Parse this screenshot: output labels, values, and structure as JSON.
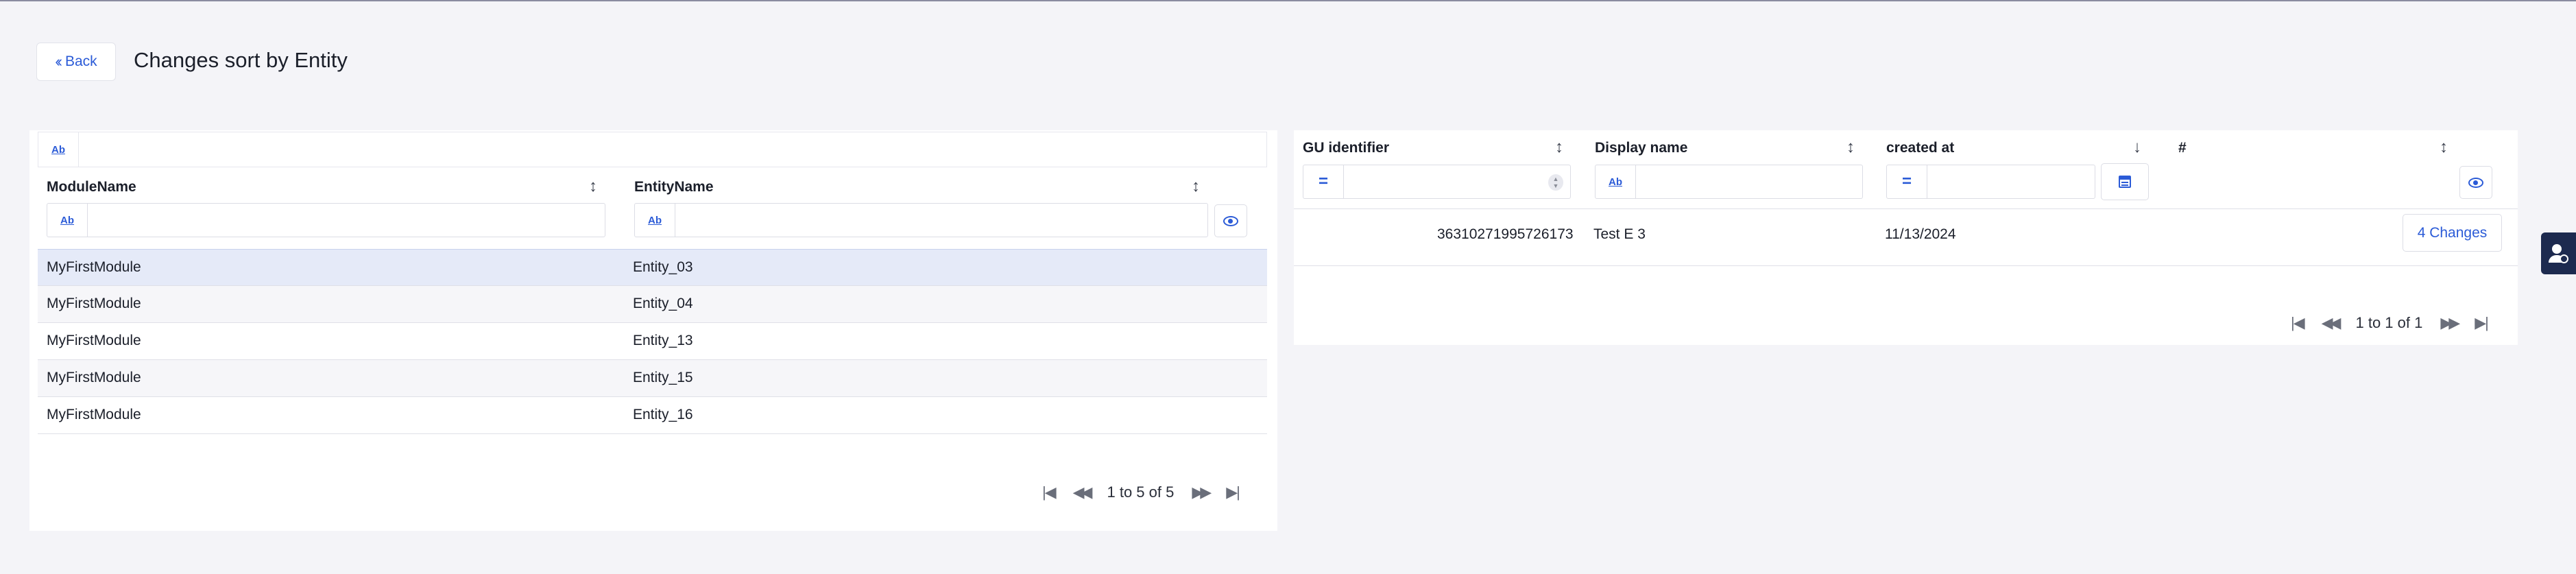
{
  "header": {
    "back_label": "Back",
    "title": "Changes sort by Entity"
  },
  "left_table": {
    "filter_prefix": "Ab",
    "columns": [
      "ModuleName",
      "EntityName"
    ],
    "rows": [
      {
        "module": "MyFirstModule",
        "entity": "Entity_03"
      },
      {
        "module": "MyFirstModule",
        "entity": "Entity_04"
      },
      {
        "module": "MyFirstModule",
        "entity": "Entity_13"
      },
      {
        "module": "MyFirstModule",
        "entity": "Entity_15"
      },
      {
        "module": "MyFirstModule",
        "entity": "Entity_16"
      }
    ],
    "pager_text": "1 to 5 of 5"
  },
  "right_table": {
    "columns": [
      "GU identifier",
      "Display name",
      "created at",
      "#"
    ],
    "filter_eq": "=",
    "filter_ab": "Ab",
    "rows": [
      {
        "gu_identifier": "36310271995726173",
        "display_name": "Test E 3",
        "created_at": "11/13/2024",
        "changes": "4 Changes"
      }
    ],
    "pager_text": "1 to 1 of 1"
  },
  "icons": {
    "back": "double-chevron-left-icon",
    "sort": "sort-updown-icon",
    "sort_desc": "arrow-down-icon",
    "eye": "eye-icon",
    "calendar": "calendar-icon",
    "pager_first": "first-page-icon",
    "pager_prev": "prev-page-icon",
    "pager_next": "next-page-icon",
    "pager_last": "last-page-icon",
    "side": "user-settings-icon"
  },
  "colors": {
    "accent": "#2b5bd7",
    "selected_row": "#e5eaf8",
    "page_bg": "#f4f4f8",
    "side_widget": "#1d2a4f"
  }
}
